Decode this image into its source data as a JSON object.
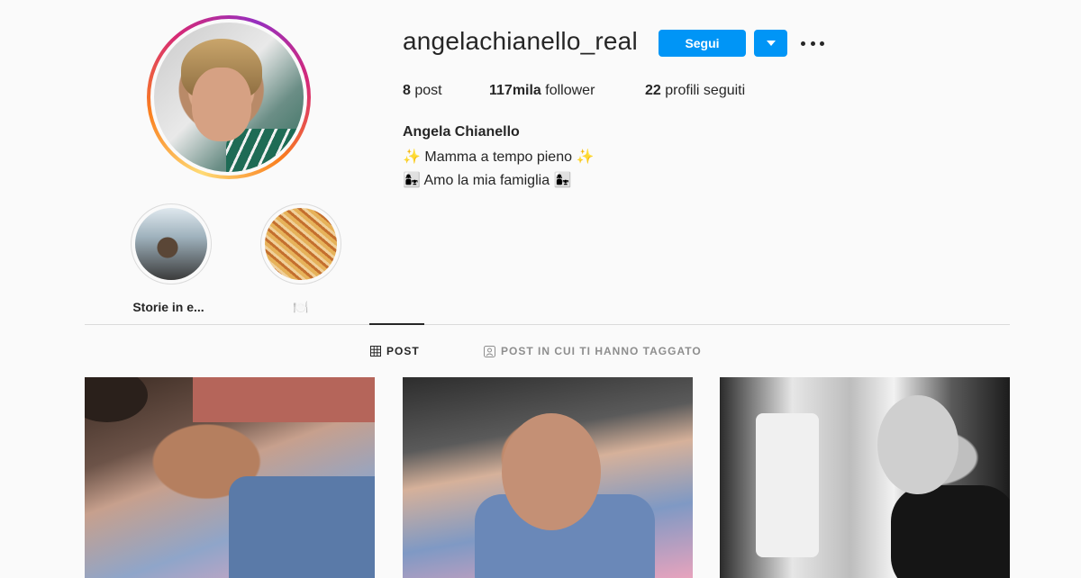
{
  "profile": {
    "username": "angelachianello_real",
    "follow_label": "Segui",
    "full_name": "Angela Chianello",
    "bio": [
      "✨ Mamma a tempo pieno ✨",
      "👩‍👧 Amo la mia famiglia 👩‍👧"
    ]
  },
  "stats": {
    "posts_count": "8",
    "posts_label": " post",
    "followers_count": "117mila",
    "followers_label": " follower",
    "following_count": "22",
    "following_label": " profili seguiti"
  },
  "highlights": [
    {
      "label": "Storie in e..."
    },
    {
      "label": "🍽️"
    }
  ],
  "tabs": [
    {
      "label": "POST",
      "icon": "grid-icon",
      "active": true
    },
    {
      "label": "POST IN CUI TI HANNO TAGGATO",
      "icon": "tagged-person-icon",
      "active": false
    }
  ],
  "posts": [
    {
      "icon": "selfie-car-photo"
    },
    {
      "icon": "selfie-tongue-photo"
    },
    {
      "icon": "kitchen-bw-photo"
    }
  ],
  "colors": {
    "accent": "#0095f6",
    "text": "#262626",
    "muted": "#8e8e8e",
    "background": "#fafafa",
    "border": "#dbdbdb"
  }
}
